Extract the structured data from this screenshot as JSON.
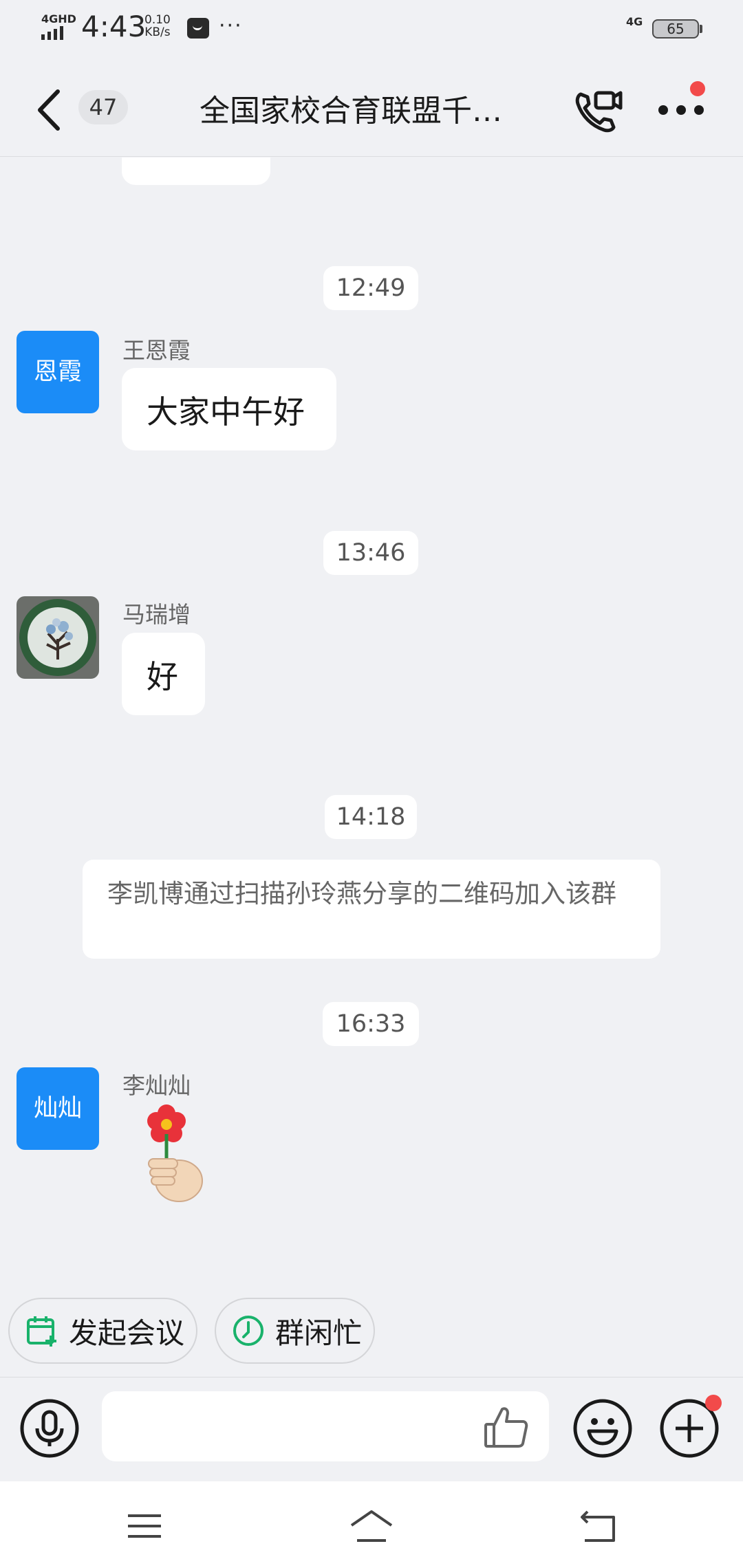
{
  "status_bar": {
    "network_tag": "4GHD",
    "time": "4:43",
    "speed_value": "0.10",
    "speed_unit": "KB/s",
    "more": "···",
    "network_type": "4G",
    "battery": "65"
  },
  "header": {
    "unread_count": "47",
    "title": "全国家校合育联盟千…"
  },
  "messages": [
    {
      "time": "12:49",
      "sender": "王恩霞",
      "avatar_text": "恩霞",
      "text": "大家中午好"
    },
    {
      "time": "13:46",
      "sender": "马瑞增",
      "text": "好"
    },
    {
      "time": "14:18",
      "system_text": "李凯博通过扫描孙玲燕分享的二维码加入该群"
    },
    {
      "time": "16:33",
      "sender": "李灿灿",
      "avatar_text": "灿灿",
      "sticker": "flower-hand-sticker"
    }
  ],
  "quick_actions": [
    {
      "label": "发起会议",
      "icon": "calendar-add-icon"
    },
    {
      "label": "群闲忙",
      "icon": "clock-icon"
    }
  ],
  "input": {
    "placeholder": ""
  },
  "colors": {
    "background": "#f0f1f4",
    "avatar_blue": "#1b8cf7",
    "badge_red": "#f24a4a",
    "chip_icon_green": "#19b26b"
  }
}
